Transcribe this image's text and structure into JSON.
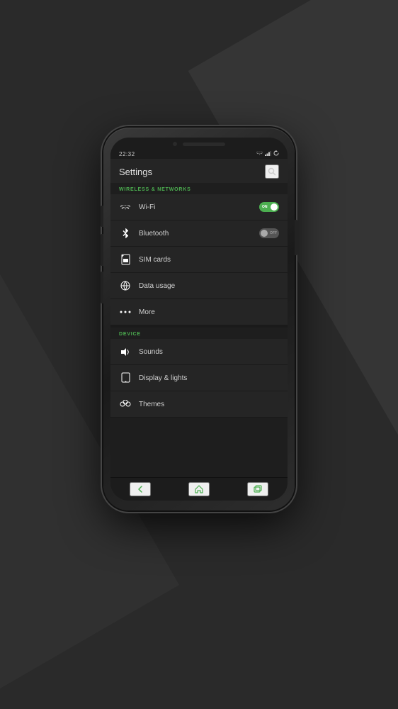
{
  "background": {
    "color": "#2a2a2a"
  },
  "phone": {
    "status_bar": {
      "time": "22:32",
      "icons": [
        "wifi",
        "signal",
        "refresh"
      ]
    },
    "header": {
      "title": "Settings",
      "search_label": "search"
    },
    "sections": [
      {
        "id": "wireless",
        "label": "WIRELESS & NETWORKS",
        "items": [
          {
            "id": "wifi",
            "icon": "wifi",
            "label": "Wi-Fi",
            "toggle": "on",
            "toggle_text": "ON"
          },
          {
            "id": "bluetooth",
            "icon": "bluetooth",
            "label": "Bluetooth",
            "toggle": "off",
            "toggle_text": "OFF"
          },
          {
            "id": "simcards",
            "icon": "sim",
            "label": "SIM cards",
            "toggle": null
          },
          {
            "id": "datausage",
            "icon": "globe",
            "label": "Data usage",
            "toggle": null
          },
          {
            "id": "more",
            "icon": "dots",
            "label": "More",
            "toggle": null
          }
        ]
      },
      {
        "id": "device",
        "label": "DEVICE",
        "items": [
          {
            "id": "sounds",
            "icon": "volume",
            "label": "Sounds",
            "toggle": null
          },
          {
            "id": "display",
            "icon": "display",
            "label": "Display & lights",
            "toggle": null
          },
          {
            "id": "themes",
            "icon": "themes",
            "label": "Themes",
            "toggle": null
          }
        ]
      }
    ],
    "bottom_nav": {
      "back_label": "back",
      "home_label": "home",
      "recents_label": "recents"
    }
  }
}
